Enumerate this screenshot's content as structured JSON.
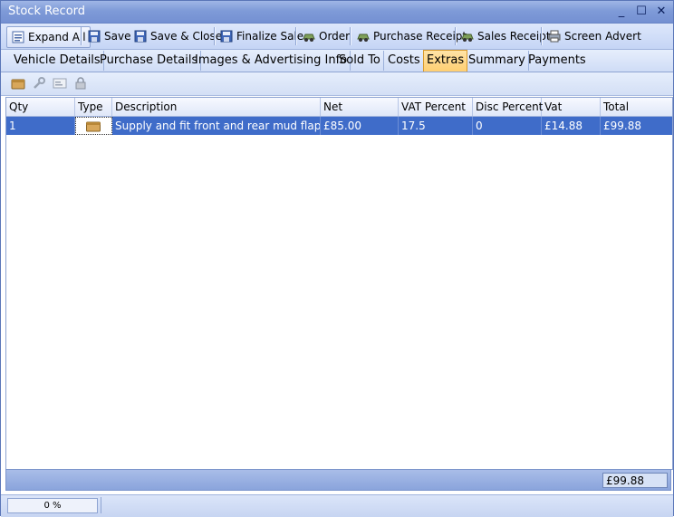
{
  "window": {
    "title": "Stock Record"
  },
  "title_controls": {
    "minimize": "_",
    "maximize": "☐",
    "close": "✕"
  },
  "toolbar": {
    "expand_all": "Expand All",
    "save": "Save",
    "save_close": "Save & Close",
    "finalize_sale": "Finalize Sale",
    "order": "Order",
    "purchase_receipt": "Purchase Receipt",
    "sales_receipt": "Sales Receipt",
    "screen_advert": "Screen Advert"
  },
  "tabs": [
    {
      "label": "Vehicle Details"
    },
    {
      "label": "Purchase Details"
    },
    {
      "label": "Images & Advertising Info"
    },
    {
      "label": "Sold To"
    },
    {
      "label": "Costs"
    },
    {
      "label": "Extras"
    },
    {
      "label": "Summary"
    },
    {
      "label": "Payments"
    }
  ],
  "active_tab": "Extras",
  "grid": {
    "columns": [
      "Qty",
      "Type",
      "Description",
      "Net",
      "VAT Percent",
      "Disc Percent",
      "Vat",
      "Total"
    ],
    "rows": [
      {
        "qty": "1",
        "type_icon": "box-icon",
        "description": "Supply and fit front and rear mud flaps",
        "net": "£85.00",
        "vat_percent": "17.5",
        "disc_percent": "0",
        "vat": "£14.88",
        "total": "£99.88"
      }
    ],
    "footer_total": "£99.88"
  },
  "status": {
    "progress": "0 %"
  },
  "colors": {
    "selection": "#3f6cc9",
    "title_bar": "#7f9bd8",
    "active_tab": "#ffcf72"
  }
}
